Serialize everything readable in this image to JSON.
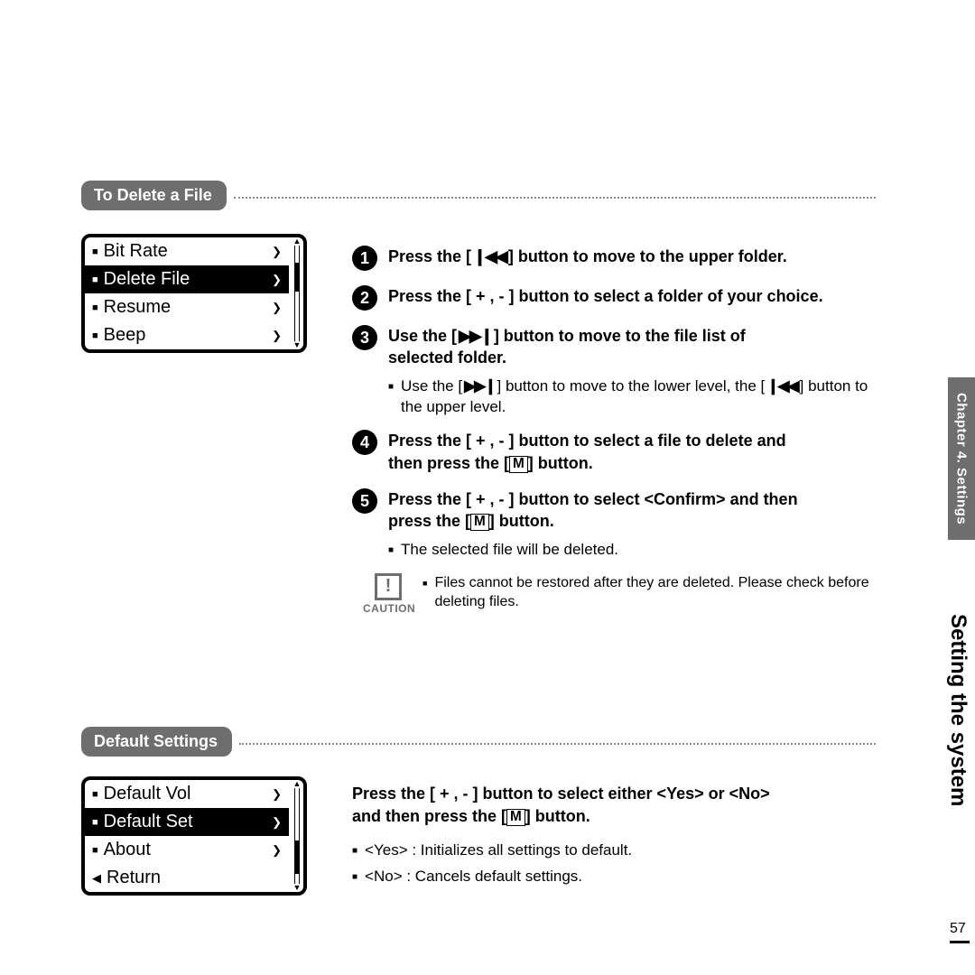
{
  "section1": {
    "title": "To Delete a File",
    "menu": [
      {
        "label": "Bit Rate",
        "selected": false,
        "arrow": true
      },
      {
        "label": "Delete  File",
        "selected": true,
        "arrow": true
      },
      {
        "label": "Resume",
        "selected": false,
        "arrow": true
      },
      {
        "label": "Beep",
        "selected": false,
        "arrow": true
      }
    ],
    "steps": {
      "s1": "Press the [ ⏮ ] button to move to the upper folder.",
      "s2": "Press the [ + , - ] button to select a folder of your choice.",
      "s3a": "Use the [ ⏭ ] button to move to the file list of",
      "s3b": "selected folder.",
      "s3_sub": "Use the [ ⏭ ] button to move to the lower level, the [ ⏮ ] button to the upper level.",
      "s4a": "Press the [ + , - ] button to select a file to delete and",
      "s4b": "then press the [ M ] button.",
      "s5a": "Press the [ + , - ] button to select <Confirm> and then",
      "s5b": "press the [ M ] button.",
      "s5_sub": "The selected file will be deleted."
    },
    "caution": {
      "label": "CAUTION",
      "text": "Files cannot be restored after they are deleted. Please check before deleting files."
    }
  },
  "section2": {
    "title": "Default Settings",
    "menu": [
      {
        "label": "Default Vol",
        "selected": false,
        "type": "item"
      },
      {
        "label": "Default Set",
        "selected": true,
        "type": "item"
      },
      {
        "label": "About",
        "selected": false,
        "type": "item"
      },
      {
        "label": "Return",
        "selected": false,
        "type": "return"
      }
    ],
    "main1": "Press the [ + , - ] button to select either <Yes> or <No>",
    "main2": "and then press the [ M ] button.",
    "yes": "<Yes>  :  Initializes all settings to default.",
    "no": "<No> : Cancels default settings."
  },
  "side": {
    "tab": "Chapter 4. Settings",
    "title": "Setting the system",
    "page": "57"
  },
  "icons": {
    "prev": "❙◀◀",
    "next": "▶▶❙",
    "m": "M"
  }
}
